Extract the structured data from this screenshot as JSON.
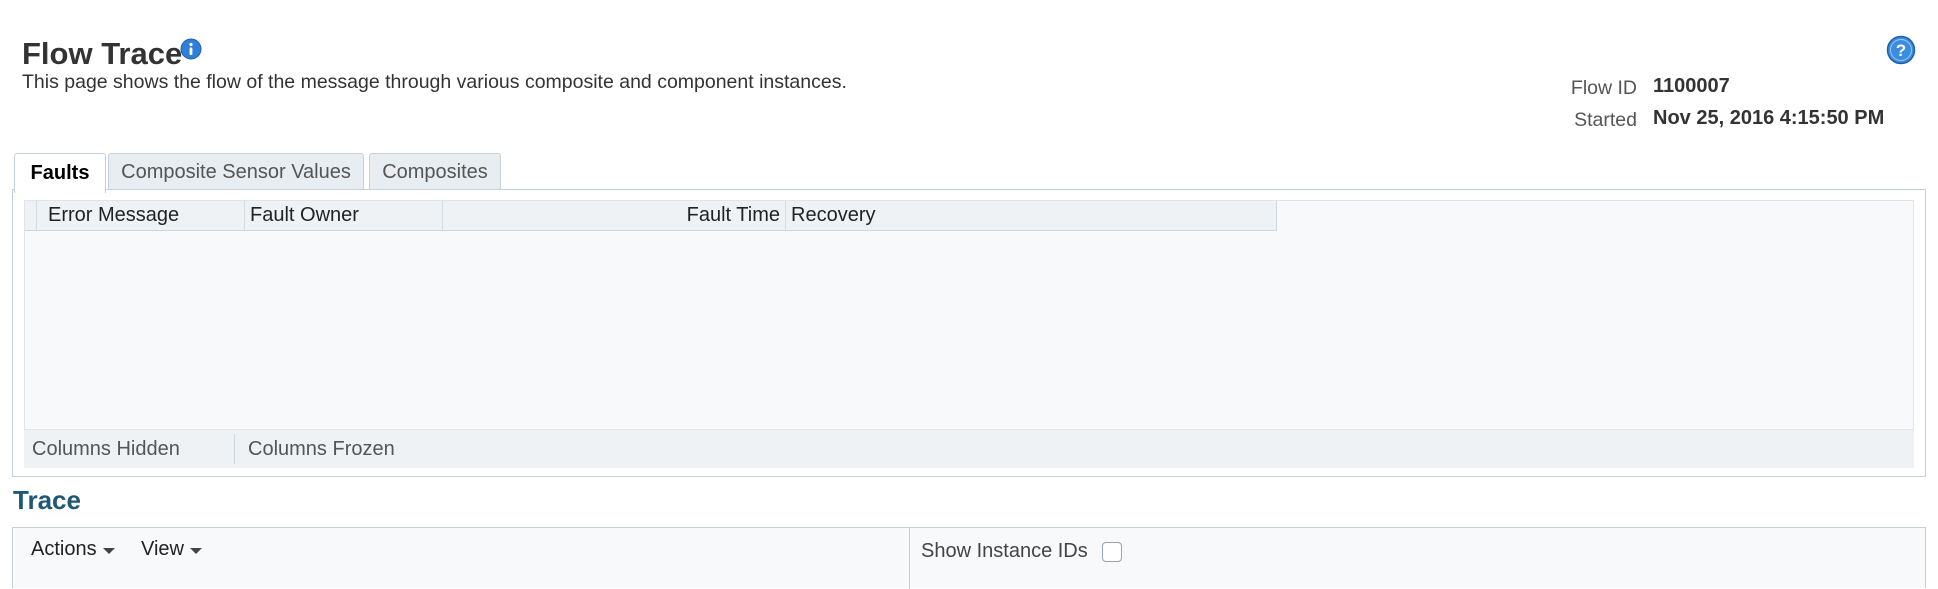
{
  "header": {
    "title": "Flow Trace",
    "description": "This page shows the flow of the message through various composite and component instances.",
    "info_icon": "info-icon",
    "help_icon": "help-icon"
  },
  "flow": {
    "id_label": "Flow ID",
    "id_value": "1100007",
    "started_label": "Started",
    "started_value": "Nov 25, 2016 4:15:50 PM"
  },
  "tabs": [
    {
      "label": "Faults",
      "active": true
    },
    {
      "label": "Composite Sensor Values",
      "active": false
    },
    {
      "label": "Composites",
      "active": false
    }
  ],
  "faults_table": {
    "columns": [
      "Error Message",
      "Fault Owner",
      "Fault Time",
      "Recovery"
    ],
    "rows": [],
    "footer": {
      "columns_hidden": "Columns Hidden",
      "columns_frozen": "Columns Frozen"
    }
  },
  "trace": {
    "title": "Trace",
    "toolbar": {
      "actions_label": "Actions",
      "view_label": "View",
      "show_instance_ids_label": "Show Instance IDs",
      "show_instance_ids_checked": false
    }
  },
  "colors": {
    "section_title": "#1f5775",
    "info_icon": "#2f7fd8",
    "tab_inactive_bg": "#e8edf1"
  }
}
